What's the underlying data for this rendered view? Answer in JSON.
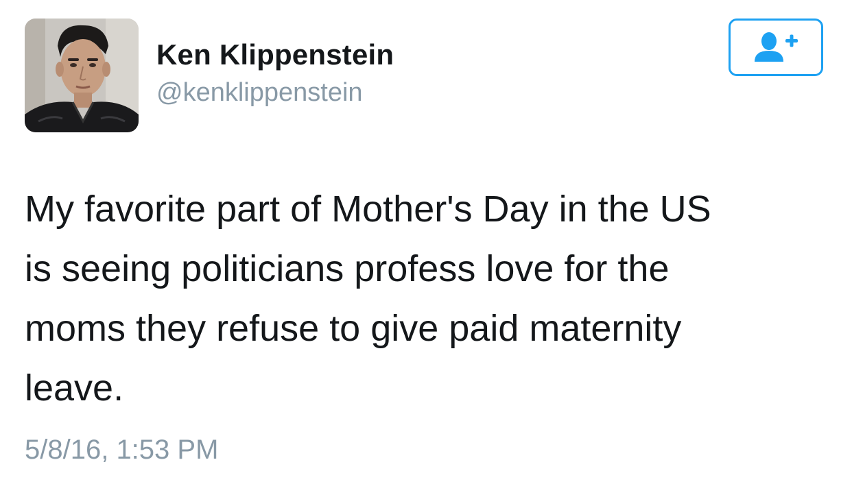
{
  "author": {
    "name": "Ken Klippenstein",
    "handle": "@kenklippenstein",
    "avatar": "profile-photo"
  },
  "follow_button": {
    "icon": "add-user-icon",
    "color": "#1da1f2"
  },
  "tweet": {
    "lines": [
      "My favorite part of Mother's Day in the US",
      "is seeing politicians profess love for the",
      "moms they refuse to give paid maternity",
      "leave."
    ],
    "timestamp": "5/8/16, 1:53 PM"
  },
  "colors": {
    "text": "#14171a",
    "muted": "#8899a6",
    "accent": "#1da1f2",
    "background": "#ffffff"
  }
}
